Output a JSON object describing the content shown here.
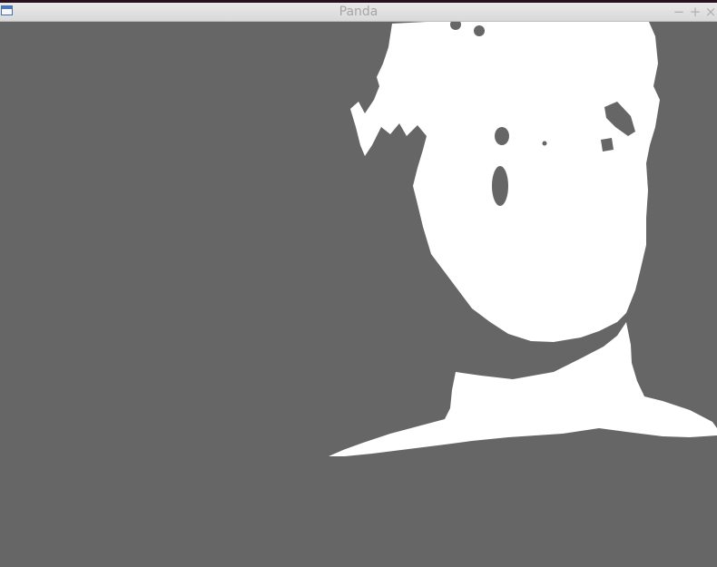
{
  "window": {
    "title": "Panda",
    "controls": {
      "minimize": "−",
      "maximize": "+",
      "close": "×"
    }
  },
  "colors": {
    "background": "#666666",
    "foreground": "#ffffff",
    "titlebar": "#e3e3e3",
    "title_text": "#a6a6a6"
  },
  "icons": {
    "app": "window-icon"
  }
}
